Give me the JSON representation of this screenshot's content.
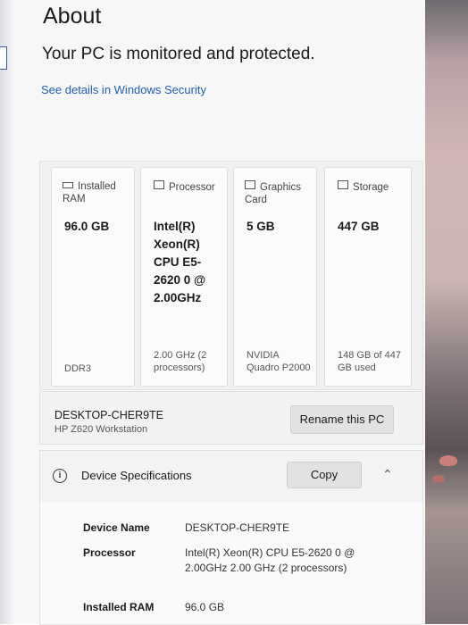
{
  "page": {
    "title": "About",
    "protection_status": "Your PC is monitored and protected.",
    "security_link": "See details in Windows Security"
  },
  "specs": [
    {
      "label": "Installed RAM",
      "icon": "ram-icon",
      "value": "96.0 GB",
      "sub": "DDR3"
    },
    {
      "label": "Processor",
      "icon": "processor-icon",
      "value": "Intel(R) Xeon(R) CPU E5-2620 0 @ 2.00GHz",
      "sub": "2.00 GHz (2 processors)"
    },
    {
      "label": "Graphics Card",
      "icon": "graphics-card-icon",
      "value": "5 GB",
      "sub": "NVIDIA Quadro P2000"
    },
    {
      "label": "Storage",
      "icon": "storage-icon",
      "value": "447 GB",
      "sub": "148 GB of 447 GB used"
    }
  ],
  "pc": {
    "name": "DESKTOP-CHER9TE",
    "model": "HP Z620 Workstation",
    "rename_label": "Rename this PC"
  },
  "device_specs": {
    "title": "Device Specifications",
    "copy_label": "Copy",
    "rows": [
      {
        "label": "Device Name",
        "value": "DESKTOP-CHER9TE"
      },
      {
        "label": "Processor",
        "value": "Intel(R) Xeon(R) CPU E5-2620 0 @ 2.00GHz 2.00 GHz (2 processors)"
      },
      {
        "label": "Installed RAM",
        "value": "96.0 GB"
      }
    ]
  }
}
